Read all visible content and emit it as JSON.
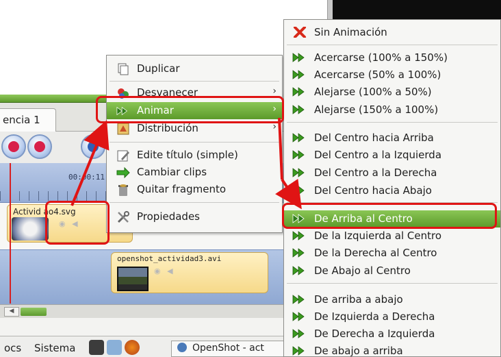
{
  "timeline": {
    "tab_label": "encia 1",
    "ruler_time": "00:00:11",
    "clip1_name": "Activid ao4.svg",
    "clip2_name": "openshot_actividad3.avi"
  },
  "taskbar": {
    "docs": "ocs",
    "sistema": "Sistema",
    "task_label": "OpenShot - act"
  },
  "context_menu": {
    "items": [
      {
        "label": "Duplicar",
        "icon": "duplicate-icon"
      },
      {
        "label": "Desvanecer",
        "icon": "fade-icon",
        "submenu": true
      },
      {
        "label": "Animar",
        "icon": "animate-icon",
        "submenu": true,
        "highlighted": true
      },
      {
        "label": "Distribución",
        "icon": "distribute-icon",
        "submenu": true
      },
      {
        "label": "Edite título (simple)",
        "icon": "edit-title-icon"
      },
      {
        "label": "Cambiar clips",
        "icon": "swap-clips-icon"
      },
      {
        "label": "Quitar fragmento",
        "icon": "remove-fragment-icon"
      },
      {
        "label": "Propiedades",
        "icon": "properties-icon"
      }
    ],
    "submenu_arrow": "›"
  },
  "animate_submenu": {
    "items": [
      {
        "label": "Sin Animación",
        "icon": "no-animation-x-icon"
      },
      {
        "label": "Acercarse (100% a 150%)",
        "icon": "green-double-arrow-icon"
      },
      {
        "label": "Acercarse (50% a 100%)",
        "icon": "green-double-arrow-icon"
      },
      {
        "label": "Alejarse (100% a 50%)",
        "icon": "green-double-arrow-icon"
      },
      {
        "label": "Alejarse (150% a 100%)",
        "icon": "green-double-arrow-icon"
      },
      {
        "label": "Del Centro hacia Arriba",
        "icon": "green-double-arrow-icon"
      },
      {
        "label": "Del Centro a la Izquierda",
        "icon": "green-double-arrow-icon"
      },
      {
        "label": "Del Centro a la Derecha",
        "icon": "green-double-arrow-icon"
      },
      {
        "label": "Del Centro hacia Abajo",
        "icon": "green-double-arrow-icon"
      },
      {
        "label": "De Arriba al Centro",
        "icon": "green-double-arrow-icon",
        "highlighted": true
      },
      {
        "label": "De la Izquierda al Centro",
        "icon": "green-double-arrow-icon"
      },
      {
        "label": "De la Derecha al Centro",
        "icon": "green-double-arrow-icon"
      },
      {
        "label": "De Abajo al Centro",
        "icon": "green-double-arrow-icon"
      },
      {
        "label": "De arriba a abajo",
        "icon": "green-double-arrow-icon"
      },
      {
        "label": "De Izquierda a Derecha",
        "icon": "green-double-arrow-icon"
      },
      {
        "label": "De Derecha a Izquierda",
        "icon": "green-double-arrow-icon"
      },
      {
        "label": "De abajo a arriba",
        "icon": "green-double-arrow-icon"
      }
    ]
  },
  "colors": {
    "highlight": "#6aa834",
    "annotation_red": "#e01414"
  }
}
